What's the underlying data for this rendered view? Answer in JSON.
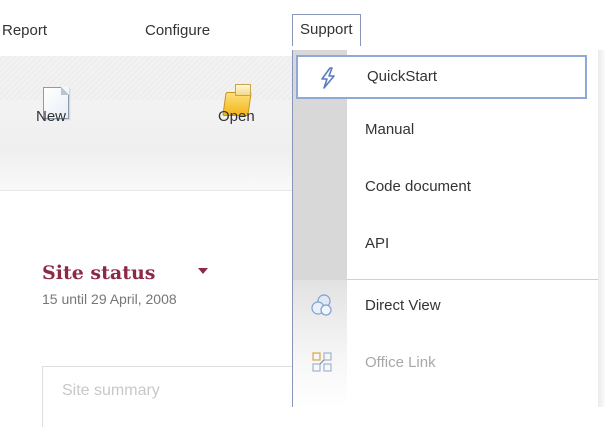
{
  "menubar": {
    "items": [
      "Report",
      "Configure",
      "Support"
    ]
  },
  "toolbar": {
    "new_label": "New",
    "open_label": "Open"
  },
  "site": {
    "title": "Site status",
    "date": "15 until 29 April, 2008",
    "summary_label": "Site summary"
  },
  "dropdown": {
    "items": [
      {
        "label": "QuickStart",
        "icon": "lightning-icon",
        "highlighted": true
      },
      {
        "label": "Manual"
      },
      {
        "label": "Code document"
      },
      {
        "label": "API"
      },
      {
        "label": "Direct View",
        "icon": "circles-icon"
      },
      {
        "label": "Office Link",
        "icon": "office-link-icon",
        "disabled": true
      }
    ]
  },
  "colors": {
    "accent": "#8b2946",
    "highlight_border": "#8fa9d6",
    "menu_border": "#8a96b8"
  }
}
